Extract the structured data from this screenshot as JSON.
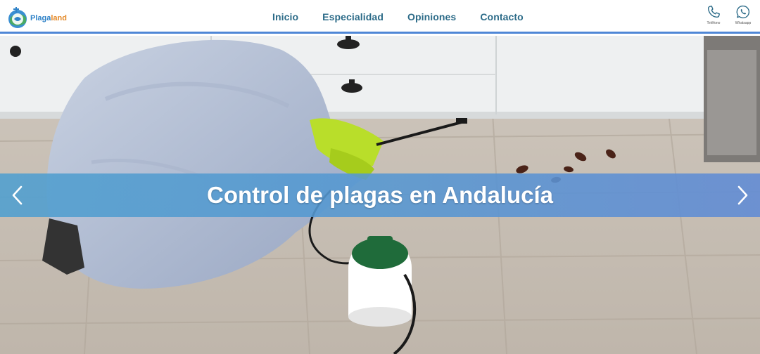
{
  "brand": {
    "logo_part1": "Plaga",
    "logo_part2": "land",
    "logo_icon": "globe-cross-logo"
  },
  "nav": {
    "items": [
      {
        "label": "Inicio"
      },
      {
        "label": "Especialidad"
      },
      {
        "label": "Opiniones"
      },
      {
        "label": "Contacto"
      }
    ]
  },
  "contact": {
    "phone": {
      "label": "Teléfono",
      "icon": "phone-icon"
    },
    "whatsapp": {
      "label": "Whatsapp",
      "icon": "whatsapp-icon"
    }
  },
  "hero": {
    "title": "Control de plagas en Andalucía",
    "prev_icon": "chevron-left-icon",
    "next_icon": "chevron-right-icon"
  },
  "colors": {
    "nav_text": "#2c6b88",
    "header_border": "#4f87d6",
    "caption_band": "#5a9ad2",
    "logo_blue": "#2f82c8",
    "logo_orange": "#e48a2a"
  }
}
